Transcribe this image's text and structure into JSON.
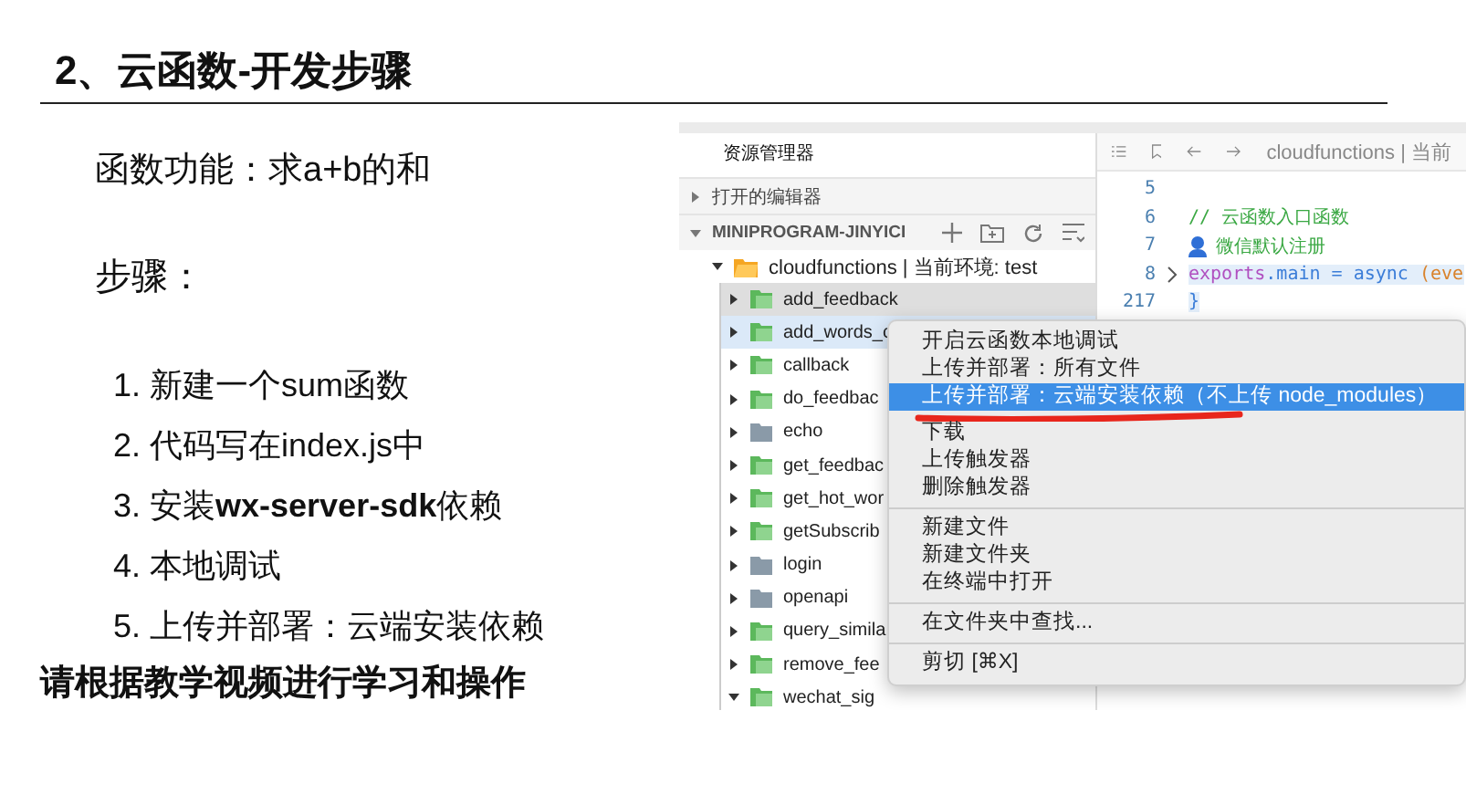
{
  "slide": {
    "title": "2、云函数-开发步骤",
    "function_line": "函数功能：求a+b的和",
    "steps_heading": "步骤：",
    "steps": [
      "1. 新建一个sum函数",
      "2. 代码写在index.js中",
      "3. 安装**wx-server-sdk**依赖",
      "4. 本地调试",
      "5. 上传并部署：云端安装依赖"
    ],
    "footer": "请根据教学视频进行学习和操作"
  },
  "screenshot": {
    "explorer": {
      "title": "资源管理器",
      "sections": [
        {
          "label": "打开的编辑器",
          "expanded": false,
          "kind": "plain"
        },
        {
          "label": "MINIPROGRAM-JINYICI",
          "expanded": true,
          "kind": "project"
        }
      ],
      "root": {
        "label": "cloudfunctions | 当前环境: test",
        "expanded": true
      },
      "tree": [
        {
          "label": "add_feedback",
          "kind": "cloud",
          "expanded": false,
          "selected": false,
          "hovered": true
        },
        {
          "label": "add_words_c",
          "kind": "cloud",
          "expanded": false,
          "selected": true,
          "hovered": false
        },
        {
          "label": "callback",
          "kind": "cloud",
          "expanded": false,
          "selected": false,
          "hovered": false
        },
        {
          "label": "do_feedbac",
          "kind": "cloud",
          "expanded": false,
          "selected": false,
          "hovered": false
        },
        {
          "label": "echo",
          "kind": "plain",
          "expanded": false,
          "selected": false,
          "hovered": false
        },
        {
          "label": "get_feedbac",
          "kind": "cloud",
          "expanded": false,
          "selected": false,
          "hovered": false
        },
        {
          "label": "get_hot_wor",
          "kind": "cloud",
          "expanded": false,
          "selected": false,
          "hovered": false
        },
        {
          "label": "getSubscrib",
          "kind": "cloud",
          "expanded": false,
          "selected": false,
          "hovered": false
        },
        {
          "label": "login",
          "kind": "plain",
          "expanded": false,
          "selected": false,
          "hovered": false
        },
        {
          "label": "openapi",
          "kind": "plain",
          "expanded": false,
          "selected": false,
          "hovered": false
        },
        {
          "label": "query_simila",
          "kind": "cloud",
          "expanded": false,
          "selected": false,
          "hovered": false
        },
        {
          "label": "remove_fee",
          "kind": "cloud",
          "expanded": false,
          "selected": false,
          "hovered": false
        },
        {
          "label": "wechat_sig",
          "kind": "cloud",
          "expanded": true,
          "selected": false,
          "hovered": false
        }
      ]
    },
    "editor": {
      "breadcrumb": "cloudfunctions | 当前",
      "lines": [
        {
          "number": "5",
          "kind": "blank"
        },
        {
          "number": "6",
          "kind": "comment",
          "text": "// 云函数入口函数"
        },
        {
          "number": "7",
          "kind": "blame",
          "text": "微信默认注册"
        },
        {
          "number": "8",
          "kind": "code",
          "folded": true,
          "tokens": [
            {
              "text": "exports",
              "kind": "keyword"
            },
            {
              "text": ".main = ",
              "kind": "member"
            },
            {
              "text": "async",
              "kind": "member"
            },
            {
              "text": " (eve",
              "kind": "param"
            }
          ]
        },
        {
          "number": "217",
          "kind": "code",
          "tokens": [
            {
              "text": "}",
              "kind": "brace"
            }
          ]
        }
      ]
    },
    "context_menu": {
      "groups": [
        [
          {
            "label": "开启云函数本地调试",
            "selected": false
          },
          {
            "label": "上传并部署：所有文件",
            "selected": false
          },
          {
            "label": "上传并部署：云端安装依赖（不上传 node_modules）",
            "selected": true
          },
          {
            "label": "下载",
            "selected": false
          },
          {
            "label": "上传触发器",
            "selected": false
          },
          {
            "label": "删除触发器",
            "selected": false
          }
        ],
        [
          {
            "label": "新建文件",
            "selected": false
          },
          {
            "label": "新建文件夹",
            "selected": false
          },
          {
            "label": "在终端中打开",
            "selected": false
          }
        ],
        [
          {
            "label": "在文件夹中查找...",
            "selected": false
          }
        ],
        [
          {
            "label": "剪切 [⌘X]",
            "selected": false
          }
        ]
      ]
    }
  }
}
